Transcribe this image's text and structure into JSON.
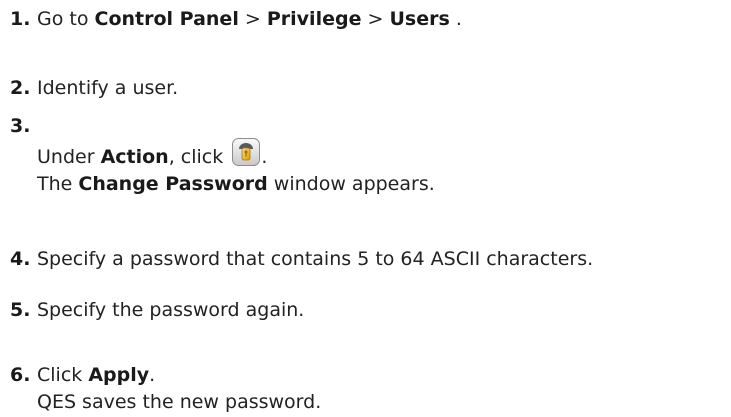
{
  "steps": [
    {
      "number": "1.",
      "prefix": "Go to",
      "path": [
        "Control Panel",
        "Privilege",
        "Users"
      ],
      "separator": ">",
      "suffix": "."
    },
    {
      "number": "2.",
      "text": "Identify a user."
    },
    {
      "number": "3.",
      "line1_prefix": "Under",
      "line1_bold": "Action",
      "line1_mid": ", click",
      "icon": "change-password-key-icon",
      "line1_suffix": ".",
      "line2_prefix": "The",
      "line2_bold": "Change Password",
      "line2_suffix": "window appears."
    },
    {
      "number": "4.",
      "text": "Specify a password that contains 5 to 64 ASCII characters."
    },
    {
      "number": "5.",
      "text": "Specify the password again."
    },
    {
      "number": "6.",
      "line1_prefix": "Click",
      "line1_bold": "Apply",
      "line1_suffix": ".",
      "line2": "QES saves the new password."
    }
  ]
}
